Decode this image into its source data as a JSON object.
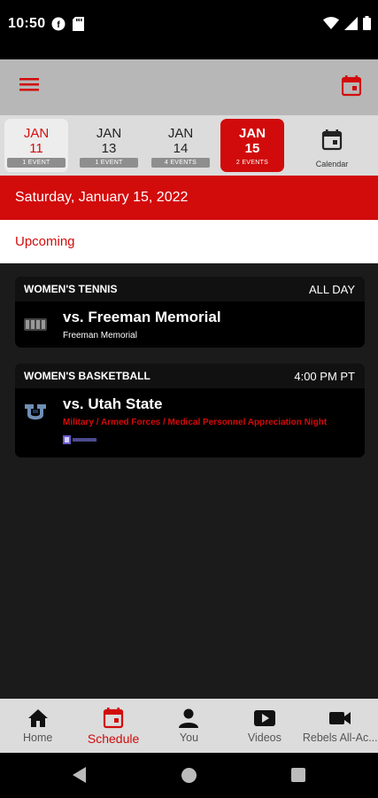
{
  "status_bar": {
    "time": "10:50",
    "icons_left": [
      "f-circle-icon",
      "sd-card-icon"
    ],
    "icons_right": [
      "wifi-icon",
      "signal-icon",
      "battery-icon"
    ]
  },
  "app_bar": {
    "menu_icon": "hamburger-menu-icon",
    "calendar_icon": "calendar-today-icon"
  },
  "date_tabs": [
    {
      "month": "JAN",
      "day": "11",
      "badge": "1 EVENT",
      "state": "first"
    },
    {
      "month": "JAN",
      "day": "13",
      "badge": "1 EVENT",
      "state": "normal"
    },
    {
      "month": "JAN",
      "day": "14",
      "badge": "4 EVENTS",
      "state": "normal"
    },
    {
      "month": "JAN",
      "day": "15",
      "badge": "2 EVENTS",
      "state": "active"
    }
  ],
  "calendar_tab": {
    "label": "Calendar"
  },
  "date_header": "Saturday, January 15, 2022",
  "section_label": "Upcoming",
  "events": [
    {
      "sport": "WOMEN'S TENNIS",
      "time": "ALL DAY",
      "title": "vs. Freeman Memorial",
      "subtitle": "Freeman Memorial",
      "subtitle_color": "#ffffff"
    },
    {
      "sport": "WOMEN'S BASKETBALL",
      "time": "4:00 PM PT",
      "title": "vs. Utah State",
      "subtitle": "Military / Armed Forces / Medical Personnel Appreciation Night",
      "subtitle_color": "#d20b0b"
    }
  ],
  "bottom_nav": [
    {
      "label": "Home",
      "icon": "home-icon",
      "active": false
    },
    {
      "label": "Schedule",
      "icon": "calendar-icon",
      "active": true
    },
    {
      "label": "You",
      "icon": "person-icon",
      "active": false
    },
    {
      "label": "Videos",
      "icon": "play-icon",
      "active": false
    },
    {
      "label": "Rebels All-Ac...",
      "icon": "video-camera-icon",
      "active": false
    }
  ],
  "colors": {
    "accent": "#d20b0b",
    "app_bar": "#b7b7b7",
    "date_strip": "#dcdcdc",
    "list_bg": "#1b1b1b",
    "card_bg": "#000000"
  }
}
